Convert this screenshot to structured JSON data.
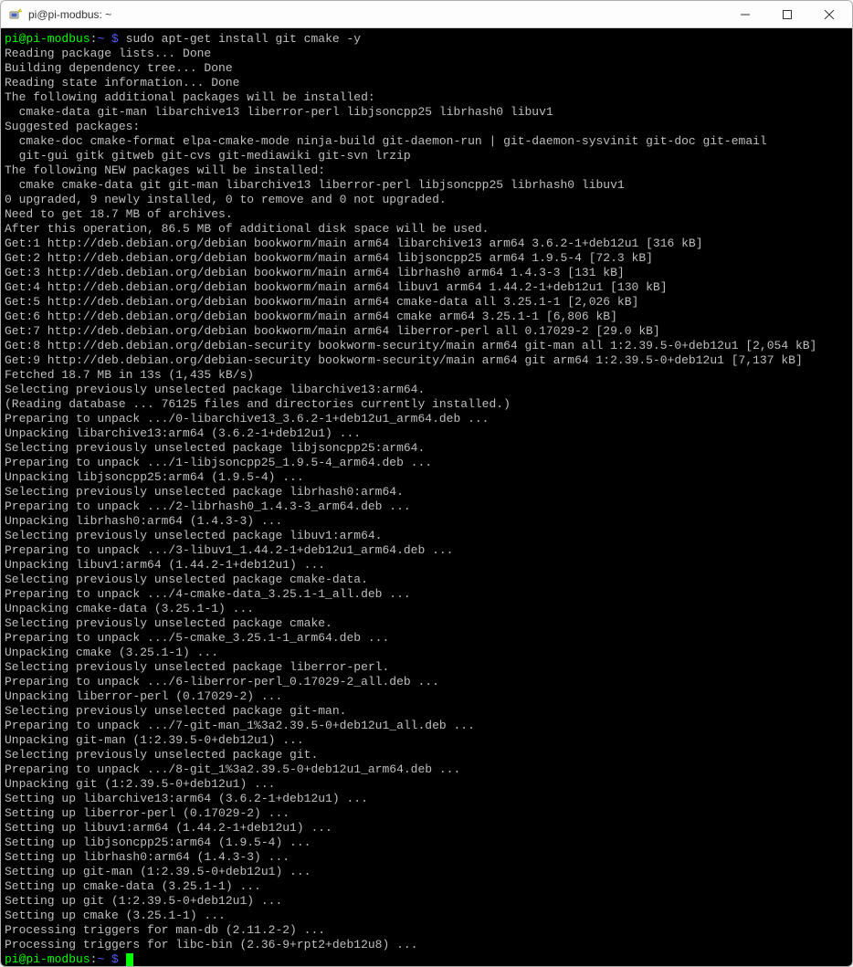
{
  "window": {
    "title": "pi@pi-modbus: ~"
  },
  "prompt": {
    "userhost": "pi@pi-modbus",
    "colon": ":",
    "path": "~ $",
    "command": " sudo apt-get install git cmake -y"
  },
  "output": [
    "Reading package lists... Done",
    "Building dependency tree... Done",
    "Reading state information... Done",
    "The following additional packages will be installed:",
    "  cmake-data git-man libarchive13 liberror-perl libjsoncpp25 librhash0 libuv1",
    "Suggested packages:",
    "  cmake-doc cmake-format elpa-cmake-mode ninja-build git-daemon-run | git-daemon-sysvinit git-doc git-email",
    "  git-gui gitk gitweb git-cvs git-mediawiki git-svn lrzip",
    "The following NEW packages will be installed:",
    "  cmake cmake-data git git-man libarchive13 liberror-perl libjsoncpp25 librhash0 libuv1",
    "0 upgraded, 9 newly installed, 0 to remove and 0 not upgraded.",
    "Need to get 18.7 MB of archives.",
    "After this operation, 86.5 MB of additional disk space will be used.",
    "Get:1 http://deb.debian.org/debian bookworm/main arm64 libarchive13 arm64 3.6.2-1+deb12u1 [316 kB]",
    "Get:2 http://deb.debian.org/debian bookworm/main arm64 libjsoncpp25 arm64 1.9.5-4 [72.3 kB]",
    "Get:3 http://deb.debian.org/debian bookworm/main arm64 librhash0 arm64 1.4.3-3 [131 kB]",
    "Get:4 http://deb.debian.org/debian bookworm/main arm64 libuv1 arm64 1.44.2-1+deb12u1 [130 kB]",
    "Get:5 http://deb.debian.org/debian bookworm/main arm64 cmake-data all 3.25.1-1 [2,026 kB]",
    "Get:6 http://deb.debian.org/debian bookworm/main arm64 cmake arm64 3.25.1-1 [6,806 kB]",
    "Get:7 http://deb.debian.org/debian bookworm/main arm64 liberror-perl all 0.17029-2 [29.0 kB]",
    "Get:8 http://deb.debian.org/debian-security bookworm-security/main arm64 git-man all 1:2.39.5-0+deb12u1 [2,054 kB]",
    "Get:9 http://deb.debian.org/debian-security bookworm-security/main arm64 git arm64 1:2.39.5-0+deb12u1 [7,137 kB]",
    "Fetched 18.7 MB in 13s (1,435 kB/s)",
    "Selecting previously unselected package libarchive13:arm64.",
    "(Reading database ... 76125 files and directories currently installed.)",
    "Preparing to unpack .../0-libarchive13_3.6.2-1+deb12u1_arm64.deb ...",
    "Unpacking libarchive13:arm64 (3.6.2-1+deb12u1) ...",
    "Selecting previously unselected package libjsoncpp25:arm64.",
    "Preparing to unpack .../1-libjsoncpp25_1.9.5-4_arm64.deb ...",
    "Unpacking libjsoncpp25:arm64 (1.9.5-4) ...",
    "Selecting previously unselected package librhash0:arm64.",
    "Preparing to unpack .../2-librhash0_1.4.3-3_arm64.deb ...",
    "Unpacking librhash0:arm64 (1.4.3-3) ...",
    "Selecting previously unselected package libuv1:arm64.",
    "Preparing to unpack .../3-libuv1_1.44.2-1+deb12u1_arm64.deb ...",
    "Unpacking libuv1:arm64 (1.44.2-1+deb12u1) ...",
    "Selecting previously unselected package cmake-data.",
    "Preparing to unpack .../4-cmake-data_3.25.1-1_all.deb ...",
    "Unpacking cmake-data (3.25.1-1) ...",
    "Selecting previously unselected package cmake.",
    "Preparing to unpack .../5-cmake_3.25.1-1_arm64.deb ...",
    "Unpacking cmake (3.25.1-1) ...",
    "Selecting previously unselected package liberror-perl.",
    "Preparing to unpack .../6-liberror-perl_0.17029-2_all.deb ...",
    "Unpacking liberror-perl (0.17029-2) ...",
    "Selecting previously unselected package git-man.",
    "Preparing to unpack .../7-git-man_1%3a2.39.5-0+deb12u1_all.deb ...",
    "Unpacking git-man (1:2.39.5-0+deb12u1) ...",
    "Selecting previously unselected package git.",
    "Preparing to unpack .../8-git_1%3a2.39.5-0+deb12u1_arm64.deb ...",
    "Unpacking git (1:2.39.5-0+deb12u1) ...",
    "Setting up libarchive13:arm64 (3.6.2-1+deb12u1) ...",
    "Setting up liberror-perl (0.17029-2) ...",
    "Setting up libuv1:arm64 (1.44.2-1+deb12u1) ...",
    "Setting up libjsoncpp25:arm64 (1.9.5-4) ...",
    "Setting up librhash0:arm64 (1.4.3-3) ...",
    "Setting up git-man (1:2.39.5-0+deb12u1) ...",
    "Setting up cmake-data (3.25.1-1) ...",
    "Setting up git (1:2.39.5-0+deb12u1) ...",
    "Setting up cmake (3.25.1-1) ...",
    "Processing triggers for man-db (2.11.2-2) ...",
    "Processing triggers for libc-bin (2.36-9+rpt2+deb12u8) ..."
  ],
  "prompt2": {
    "userhost": "pi@pi-modbus",
    "colon": ":",
    "path": "~ $"
  }
}
